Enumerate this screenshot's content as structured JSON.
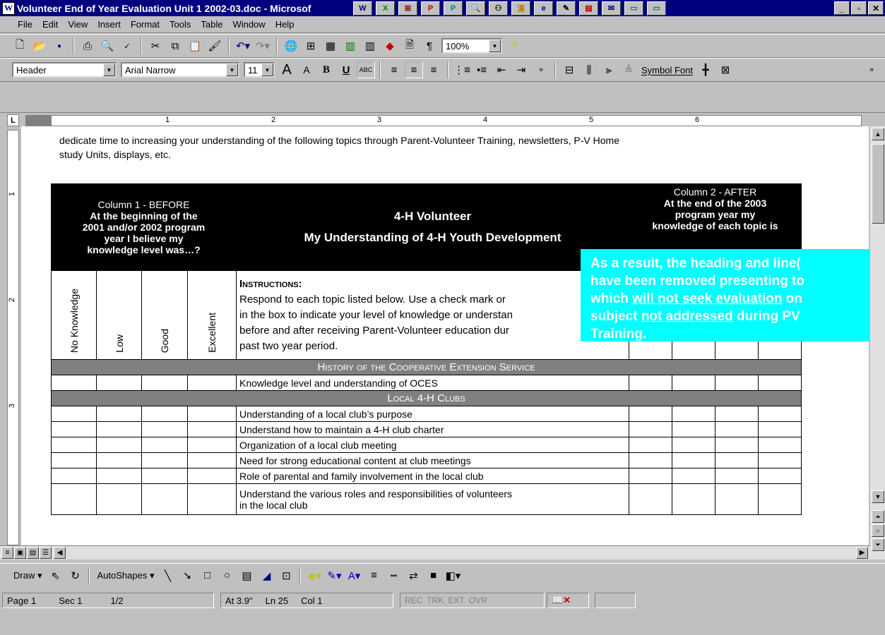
{
  "window": {
    "title": "Volunteer End of Year Evaluation Unit 1 2002-03.doc - Microsof",
    "app_icon": "W",
    "task_icons": [
      "word-icon",
      "excel-icon",
      "access-icon",
      "powerpoint-icon",
      "publisher-icon",
      "find-icon",
      "binoculars-icon",
      "ime-icon",
      "ie-icon",
      "pen-icon",
      "chart-icon",
      "outlook-icon",
      "window-icon",
      "window-icon-2"
    ],
    "controls": {
      "minimize": "_",
      "restore": "▫",
      "close": "✕"
    }
  },
  "menu": [
    "File",
    "Edit",
    "View",
    "Insert",
    "Format",
    "Tools",
    "Table",
    "Window",
    "Help"
  ],
  "standard_toolbar": {
    "zoom": "100%"
  },
  "formatting_toolbar": {
    "style": "Header",
    "font": "Arial Narrow",
    "size": "11",
    "symbol_font": "Symbol Font"
  },
  "ruler": {
    "numbers": [
      "1",
      "2",
      "3",
      "4",
      "5",
      "6"
    ],
    "vnumbers": [
      "1",
      "2",
      "3"
    ]
  },
  "document": {
    "intro_line1": "dedicate time to increasing your understanding of the following topics through Parent-Volunteer Training, newsletters, P-V Home",
    "intro_line2": "study Units, displays, etc.",
    "col1_header": {
      "line1": "Column 1 - BEFORE",
      "line2": "At the beginning of the",
      "line3": "2001 and/or 2002 program",
      "line4": "year I believe my",
      "line5": "knowledge level was…?"
    },
    "center_header": {
      "line1": "4-H Volunteer",
      "line2": "My Understanding of 4-H Youth Development"
    },
    "col2_header": {
      "line1": "Column 2 - AFTER",
      "line2": "At the end of the 2003",
      "line3": "program year my",
      "line4": "knowledge of each topic is"
    },
    "rating_labels": [
      "No Knowledge",
      "Low",
      "Good",
      "Excellent"
    ],
    "instructions": {
      "title": "Instructions:",
      "line1": "Respond to each topic listed below.  Use a check mark or",
      "line2": "in the box to indicate your level of knowledge or understan",
      "line3": "before and after receiving Parent-Volunteer education dur",
      "line4": "past two year period."
    },
    "section1": "History of the Cooperative Extension Service",
    "section1_items": [
      "Knowledge level and understanding of OCES"
    ],
    "section2": "Local 4-H Clubs",
    "section2_items": [
      "Understanding of a local club’s purpose",
      "Understand how to maintain a 4-H club charter",
      "Organization of a local club meeting",
      "Need for strong educational content at club meetings",
      "Role of parental and family involvement in the local club"
    ],
    "last_item_line1": "Understand the various roles and responsibilities of volunteers",
    "last_item_line2": "in the local club"
  },
  "callout": {
    "line1": "As a result, the heading and line(",
    "line2": "have been removed presenting to",
    "line3_pre": "which ",
    "line3_u": "will not seek evaluation",
    "line3_post": " on",
    "line4_pre": "subject ",
    "line4_u": "not addressed",
    "line4_post": " during PV",
    "line5": "Training."
  },
  "draw_toolbar": {
    "draw": "Draw",
    "autoshapes": "AutoShapes"
  },
  "statusbar": {
    "page": "Page 1",
    "sec": "Sec 1",
    "pages": "1/2",
    "at": "At 3.9\"",
    "ln": "Ln 25",
    "col": "Col 1",
    "rec": "REC",
    "trk": "TRK",
    "ext": "EXT",
    "ovr": "OVR"
  },
  "colors": {
    "titlebar": "#00007f",
    "callout": "#00ffff",
    "section": "#808080"
  }
}
